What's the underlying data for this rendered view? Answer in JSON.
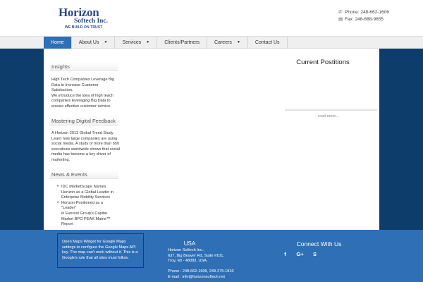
{
  "header": {
    "logo": {
      "name": "Horizon",
      "company": "Softech Inc.",
      "tagline": "WE BUILD ON TRUST"
    },
    "phone_label": "Phone: 248-662-1606",
    "fax_label": "Fax: 248-688-9655"
  },
  "nav": {
    "items": [
      {
        "label": "Home",
        "active": true,
        "has_dropdown": false
      },
      {
        "label": "About Us",
        "active": false,
        "has_dropdown": true
      },
      {
        "label": "Services",
        "active": false,
        "has_dropdown": true
      },
      {
        "label": "Clients/Partners",
        "active": false,
        "has_dropdown": false
      },
      {
        "label": "Careers",
        "active": false,
        "has_dropdown": true
      },
      {
        "label": "Contact Us",
        "active": false,
        "has_dropdown": false
      }
    ],
    "caret": "▼"
  },
  "sidebar": {
    "insights": {
      "title": "Insights",
      "lines": [
        "High Tech Companies Leverage Big",
        "Data to Increase Customer Satisfaction.",
        "We introduce the idea of high teach",
        "companies leveraging Big Data to",
        "ensure effective customer service."
      ]
    },
    "digital_feedback": {
      "title": "Mastering Digital Feedback",
      "lines": [
        "A Horizon 2013 Global Trend Study",
        "Learn how large companies are using",
        "social media. A study of more than 650",
        "executives worldwide shows that social",
        "media has become a key driver of",
        "marketing."
      ]
    },
    "news": {
      "title": "News & Events",
      "items": [
        [
          "IDC MarketScape Names",
          "Horizon as a Global Leader in",
          "Enterprise Mobility Services"
        ],
        [
          "Horizon Positioned as a \"Leader\"",
          "in Everest Group's Capital",
          "Market BPO PEAK Matrix™",
          "Report"
        ]
      ]
    }
  },
  "main": {
    "positions_title": "Current Postitions",
    "read_more": "read more..."
  },
  "footer": {
    "maps_notice_lines": [
      "Open Maps Widget for Google Maps",
      "settings to configure the Google Maps API",
      "key. The map can't work without it. This is a",
      "Google's rule that all sites must follow."
    ],
    "usa_title": "USA",
    "address_lines": [
      "Horizon Softech Inc.,",
      "637, Big Beaver Rd, Suite #101,",
      "Troy, MI - 48083, USA.",
      "",
      "Phone : 248-662-1606, 248-275-1810",
      "E-mail : info@horizonsoftech.net"
    ],
    "connect_title": "Connect With Us",
    "social": [
      {
        "icon": "facebook-icon",
        "glyph": "f"
      },
      {
        "icon": "google-plus-icon",
        "glyph": "G+"
      },
      {
        "icon": "skype-icon",
        "glyph": "S"
      }
    ]
  },
  "colors": {
    "brand_blue": "#2c4a87",
    "nav_active": "#2f6fb5",
    "main_background": "#0c3d6b",
    "footer_background": "#2f6fb5"
  }
}
